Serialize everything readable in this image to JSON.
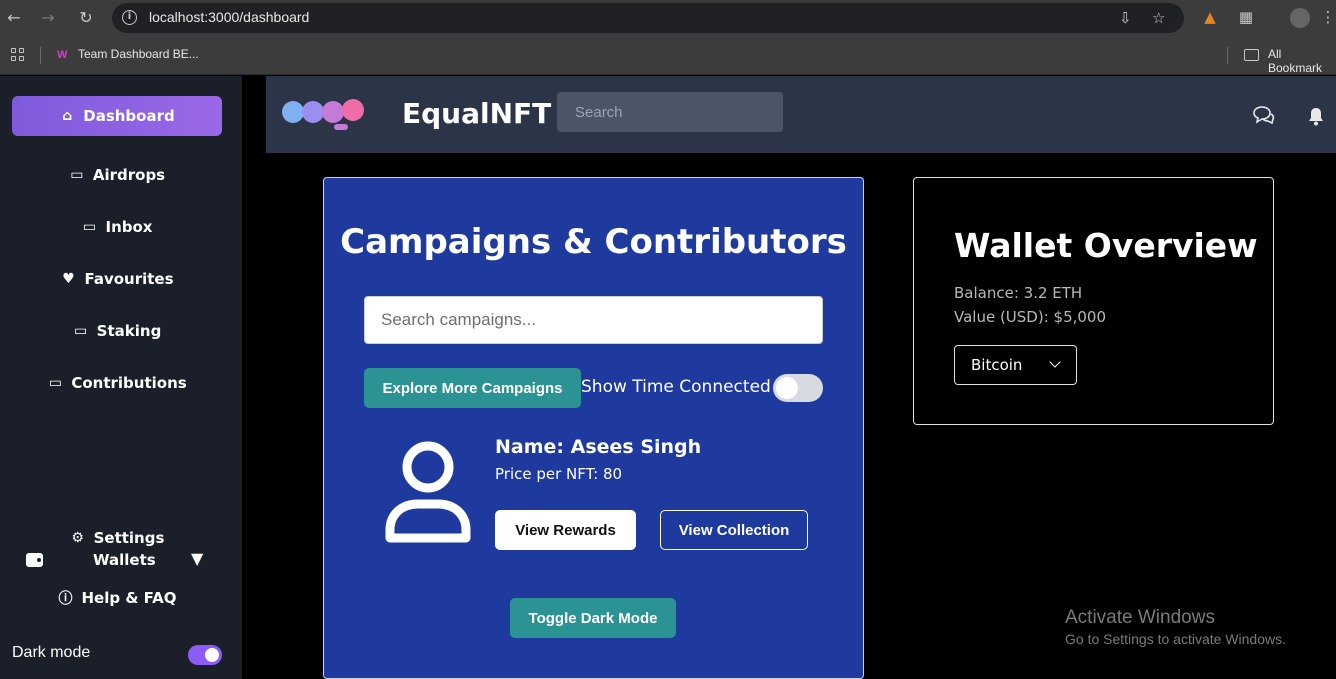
{
  "browser": {
    "url": "localhost:3000/dashboard",
    "bookmark_item": "Team Dashboard BE...",
    "all_bookmarks": "All Bookmark"
  },
  "sidebar": {
    "items": [
      {
        "label": "Dashboard",
        "icon": "home-icon"
      },
      {
        "label": "Airdrops",
        "icon": "inbox-tray-icon"
      },
      {
        "label": "Inbox",
        "icon": "inbox-tray-icon"
      },
      {
        "label": "Favourites",
        "icon": "heart-icon"
      },
      {
        "label": "Staking",
        "icon": "inbox-tray-icon"
      },
      {
        "label": "Contributions",
        "icon": "inbox-tray-icon"
      }
    ],
    "wallets_label": "Wallets",
    "settings_label": "Settings",
    "help_label": "Help & FAQ",
    "dark_mode_label": "Dark mode"
  },
  "header": {
    "brand": "EqualNFT",
    "search_placeholder": "Search"
  },
  "campaigns": {
    "title": "Campaigns & Contributors",
    "search_placeholder": "Search campaigns...",
    "explore_button": "Explore More Campaigns",
    "show_time_label": "Show Time Connected",
    "contributor_name": "Name: Asees Singh",
    "price": "Price per NFT: 80",
    "rewards_button": "View Rewards",
    "collection_button": "View Collection",
    "toggle_dark_button": "Toggle Dark Mode"
  },
  "wallet": {
    "title": "Wallet Overview",
    "balance": "Balance: 3.2 ETH",
    "value": "Value (USD): $5,000",
    "selected_currency": "Bitcoin"
  },
  "watermark": {
    "line1": "Activate Windows",
    "line2": "Go to Settings to activate Windows."
  },
  "colors": {
    "accent": "#8b5cf6",
    "teal": "#2b9393",
    "card_blue": "#1e3a9e",
    "header_bg": "#2c3548",
    "sidebar_bg": "#1b1f2a"
  }
}
